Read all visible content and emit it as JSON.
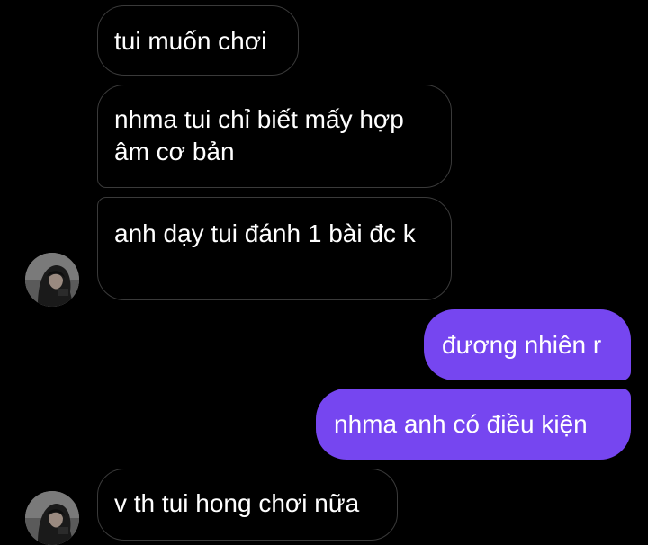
{
  "chat": {
    "messages": [
      {
        "text": "tui muốn chơi",
        "direction": "received"
      },
      {
        "text": "nhma tui chỉ biết mấy hợp âm cơ bản",
        "direction": "received"
      },
      {
        "text": "anh dạy tui đánh 1 bài đc k",
        "direction": "received"
      },
      {
        "text": "đương nhiên r",
        "direction": "sent"
      },
      {
        "text": "nhma anh có điều kiện",
        "direction": "sent"
      },
      {
        "text": "v th tui hong chơi nữa",
        "direction": "received"
      }
    ]
  },
  "colors": {
    "background": "#000000",
    "received_bubble_border": "#3a3a3a",
    "sent_bubble": "#7646f0",
    "text": "#ffffff"
  },
  "icons": {
    "avatar": "contact-avatar-hooded-figure"
  }
}
